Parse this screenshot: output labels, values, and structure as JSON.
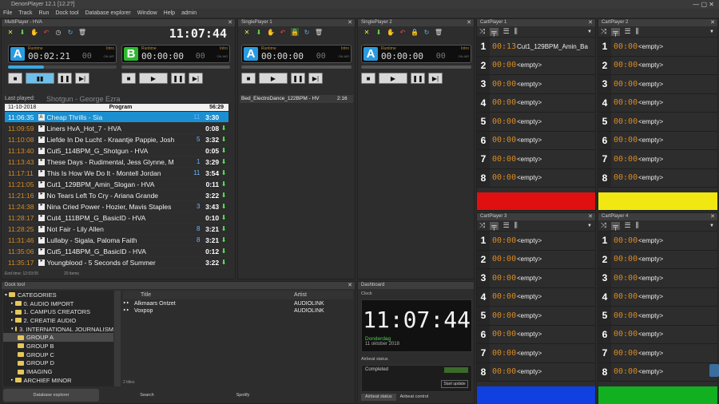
{
  "window": {
    "title": "DenonPlayer 12.1 [12.2?]"
  },
  "menu": [
    "File",
    "Track",
    "Run",
    "Dock tool",
    "Database explorer",
    "Window",
    "Help",
    "admin"
  ],
  "multiplayer": {
    "title": "MultiPlayer - HVA",
    "clock": "11:07:44",
    "player_a": {
      "letter": "A",
      "runtime_label": "Runtime",
      "runtime": "00:02:21",
      "intro_label": "Intro",
      "intro": "00",
      "on_air": "ON AIR"
    },
    "player_b": {
      "letter": "B",
      "runtime_label": "Runtime",
      "runtime": "00:00:00",
      "intro_label": "Intro",
      "intro": "00",
      "on_air": "ON AIR"
    },
    "last_played_label": "Last played:",
    "last_played": "Shotgun - George Ezra",
    "list_header": {
      "date": "11-10-2018",
      "title": "Program",
      "duration": "56:29"
    },
    "rows": [
      {
        "time": "11:06:35",
        "tag": "A",
        "title": "Cheap Thrills - Sia",
        "extra": "11",
        "dur": "3:30",
        "sel": true
      },
      {
        "time": "11:09:59",
        "tag": "⯈",
        "title": "Liners HvA_Hot_7 - HVA",
        "extra": "",
        "dur": "0:08"
      },
      {
        "time": "11:10:08",
        "tag": "⯈",
        "title": "Liefde In De Lucht - Kraantje Pappie, Josh",
        "extra": "5",
        "dur": "3:32"
      },
      {
        "time": "11:13:40",
        "tag": "⯈",
        "title": "Cut5_114BPM_G_Shotgun - HVA",
        "extra": "",
        "dur": "0:05"
      },
      {
        "time": "11:13:43",
        "tag": "⯈",
        "title": "These Days - Rudimental, Jess Glynne, M",
        "extra": "1",
        "dur": "3:29"
      },
      {
        "time": "11:17:11",
        "tag": "⯈",
        "title": "This Is How We Do It - Montell Jordan",
        "extra": "11",
        "dur": "3:54"
      },
      {
        "time": "11:21:05",
        "tag": "⯈",
        "title": "Cut1_129BPM_Amin_Slogan - HVA",
        "extra": "",
        "dur": "0:11"
      },
      {
        "time": "11:21:16",
        "tag": "⯈",
        "title": "No Tears Left To Cry - Ariana Grande",
        "extra": "",
        "dur": "3:22"
      },
      {
        "time": "11:24:38",
        "tag": "⯈",
        "title": "Nina Cried Power - Hozier, Mavis Staples",
        "extra": "3",
        "dur": "3:43"
      },
      {
        "time": "11:28:17",
        "tag": "⯈",
        "title": "Cut4_111BPM_G_BasicID - HVA",
        "extra": "",
        "dur": "0:10"
      },
      {
        "time": "11:28:25",
        "tag": "⯈",
        "title": "Not Fair - Lily Allen",
        "extra": "8",
        "dur": "3:21"
      },
      {
        "time": "11:31:46",
        "tag": "⯈",
        "title": "Lullaby - Sigala, Paloma Faith",
        "extra": "8",
        "dur": "3:21"
      },
      {
        "time": "11:35:06",
        "tag": "⯈",
        "title": "Cut5_114BPM_G_BasicID - HVA",
        "extra": "",
        "dur": "0:12"
      },
      {
        "time": "11:35:17",
        "tag": "⯈",
        "title": "Youngblood - 5 Seconds of Summer",
        "extra": "",
        "dur": "3:22"
      }
    ],
    "footer_end": "End time: 12:03:05",
    "footer_count": "20 items"
  },
  "single1": {
    "title": "SinglePlayer 1",
    "letter": "A",
    "runtime_label": "Runtime",
    "runtime": "00:00:00",
    "intro_label": "Intro",
    "intro": "00",
    "on_air": "ON AIR",
    "item": "Bed_ElectroDance_122BPM - HV",
    "item_dur": "2:16"
  },
  "single2": {
    "title": "SinglePlayer 2",
    "letter": "A",
    "runtime_label": "Runtime",
    "runtime": "00:00:00",
    "intro_label": "Intro",
    "intro": "00",
    "on_air": "ON AIR"
  },
  "carts": [
    {
      "title": "CartPlayer 1",
      "color": "#e01010",
      "items": [
        {
          "n": "1",
          "t": "00:13",
          "name": "Cut1_129BPM_Amin_Ba"
        },
        {
          "n": "2",
          "t": "00:00",
          "name": "<empty>"
        },
        {
          "n": "3",
          "t": "00:00",
          "name": "<empty>"
        },
        {
          "n": "4",
          "t": "00:00",
          "name": "<empty>"
        },
        {
          "n": "5",
          "t": "00:00",
          "name": "<empty>"
        },
        {
          "n": "6",
          "t": "00:00",
          "name": "<empty>"
        },
        {
          "n": "7",
          "t": "00:00",
          "name": "<empty>"
        },
        {
          "n": "8",
          "t": "00:00",
          "name": "<empty>"
        }
      ]
    },
    {
      "title": "CartPlayer 2",
      "color": "#f0e810",
      "items": [
        {
          "n": "1",
          "t": "00:00",
          "name": "<empty>"
        },
        {
          "n": "2",
          "t": "00:00",
          "name": "<empty>"
        },
        {
          "n": "3",
          "t": "00:00",
          "name": "<empty>"
        },
        {
          "n": "4",
          "t": "00:00",
          "name": "<empty>"
        },
        {
          "n": "5",
          "t": "00:00",
          "name": "<empty>"
        },
        {
          "n": "6",
          "t": "00:00",
          "name": "<empty>"
        },
        {
          "n": "7",
          "t": "00:00",
          "name": "<empty>"
        },
        {
          "n": "8",
          "t": "00:00",
          "name": "<empty>"
        }
      ]
    },
    {
      "title": "CartPlayer 3",
      "color": "#1040e0",
      "items": [
        {
          "n": "1",
          "t": "00:00",
          "name": "<empty>"
        },
        {
          "n": "2",
          "t": "00:00",
          "name": "<empty>"
        },
        {
          "n": "3",
          "t": "00:00",
          "name": "<empty>"
        },
        {
          "n": "4",
          "t": "00:00",
          "name": "<empty>"
        },
        {
          "n": "5",
          "t": "00:00",
          "name": "<empty>"
        },
        {
          "n": "6",
          "t": "00:00",
          "name": "<empty>"
        },
        {
          "n": "7",
          "t": "00:00",
          "name": "<empty>"
        },
        {
          "n": "8",
          "t": "00:00",
          "name": "<empty>"
        }
      ]
    },
    {
      "title": "CartPlayer 4",
      "color": "#10b020",
      "items": [
        {
          "n": "1",
          "t": "00:00",
          "name": "<empty>"
        },
        {
          "n": "2",
          "t": "00:00",
          "name": "<empty>"
        },
        {
          "n": "3",
          "t": "00:00",
          "name": "<empty>"
        },
        {
          "n": "4",
          "t": "00:00",
          "name": "<empty>"
        },
        {
          "n": "5",
          "t": "00:00",
          "name": "<empty>"
        },
        {
          "n": "6",
          "t": "00:00",
          "name": "<empty>"
        },
        {
          "n": "7",
          "t": "00:00",
          "name": "<empty>"
        },
        {
          "n": "8",
          "t": "00:00",
          "name": "<empty>"
        }
      ]
    }
  ],
  "dock": {
    "title": "Dock tool",
    "tree": [
      {
        "label": "CATEGORIES",
        "level": 0
      },
      {
        "label": "0. AUDIO IMPORT",
        "level": 1
      },
      {
        "label": "1. CAMPUS CREATORS",
        "level": 1
      },
      {
        "label": "2. CREATIE AUDIO",
        "level": 1
      },
      {
        "label": "3. INTERNATIONAL JOURNALISM",
        "level": 1
      },
      {
        "label": "GROUP A",
        "level": 2
      },
      {
        "label": "GROUP B",
        "level": 2
      },
      {
        "label": "GROUP C",
        "level": 2
      },
      {
        "label": "GROUP D",
        "level": 2
      },
      {
        "label": "IMAGING",
        "level": 2
      },
      {
        "label": "ARCHIEF MINOR",
        "level": 1
      }
    ],
    "col_title": "Title",
    "col_artist": "Artist",
    "items": [
      {
        "title": "Alkmaars Ontzet",
        "artist": "AUDIOLINK"
      },
      {
        "title": "Voxpop",
        "artist": "AUDIOLINK"
      }
    ],
    "count": "2 titles",
    "tabs": [
      "Database explorer",
      "Search",
      "Spotify"
    ]
  },
  "dashboard": {
    "title": "Dashboard",
    "clock_label": "Clock",
    "clock": "11:07:44",
    "day": "Donderdag",
    "date": "11 oktober 2018",
    "airbeat_label": "Airbeat status",
    "status": "Completed",
    "update_btn": "Start update",
    "tabs": [
      "Airbeat status",
      "Airbeat control"
    ]
  }
}
